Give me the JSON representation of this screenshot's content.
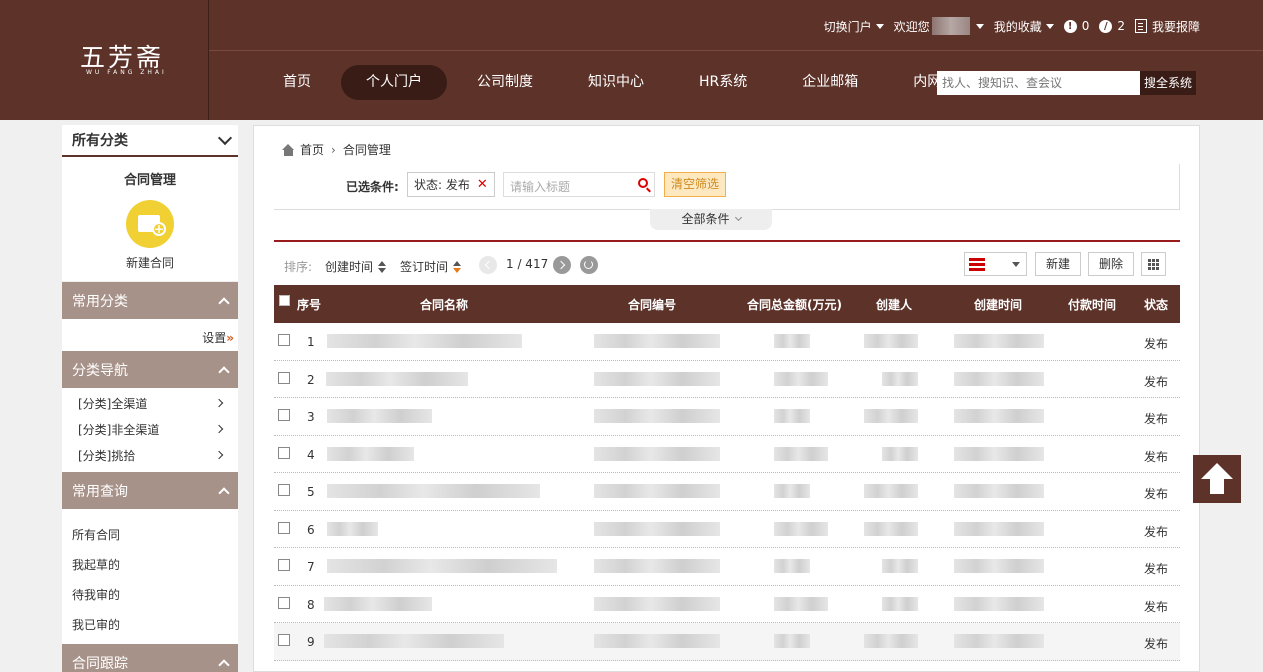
{
  "header": {
    "logo": "五芳斋",
    "logo_sub": "WU FANG ZHAI",
    "top_links": {
      "switch_portal": "切换门户",
      "welcome": "欢迎您",
      "favorites": "我的收藏",
      "alerts_count": "0",
      "tasks_count": "2",
      "report": "我要报障"
    },
    "nav": [
      "首页",
      "个人门户",
      "公司制度",
      "知识中心",
      "HR系统",
      "企业邮箱",
      "内网"
    ],
    "search_placeholder": "找人、搜知识、查会议",
    "search_button": "搜全系统"
  },
  "sidebar": {
    "all_categories": "所有分类",
    "module_title": "合同管理",
    "new_contract": "新建合同",
    "common_categories": "常用分类",
    "settings": "设置",
    "category_nav": "分类导航",
    "category_items": [
      "[分类]全渠道",
      "[分类]非全渠道",
      "[分类]挑拾"
    ],
    "common_query": "常用查询",
    "query_items": [
      "所有合同",
      "我起草的",
      "待我审的",
      "我已审的"
    ],
    "contract_tracking": "合同跟踪"
  },
  "main": {
    "breadcrumb": [
      "首页",
      "合同管理"
    ],
    "filter": {
      "selected_label": "已选条件:",
      "chip": "状态: 发布",
      "search_placeholder": "请输入标题",
      "clear": "清空筛选",
      "all_conditions": "全部条件"
    },
    "toolbar": {
      "sort_label": "排序:",
      "sort_created": "创建时间",
      "sort_signed": "签订时间",
      "page": "1 / 417",
      "new": "新建",
      "delete": "删除"
    },
    "table": {
      "columns": [
        "序号",
        "合同名称",
        "合同编号",
        "合同总金额(万元)",
        "创建人",
        "创建时间",
        "付款时间",
        "状态"
      ],
      "rows": [
        {
          "idx": "1",
          "status": "发布"
        },
        {
          "idx": "2",
          "status": "发布"
        },
        {
          "idx": "3",
          "status": "发布"
        },
        {
          "idx": "4",
          "status": "发布"
        },
        {
          "idx": "5",
          "status": "发布"
        },
        {
          "idx": "6",
          "status": "发布"
        },
        {
          "idx": "7",
          "status": "发布"
        },
        {
          "idx": "8",
          "status": "发布"
        },
        {
          "idx": "9",
          "status": "发布"
        }
      ]
    }
  }
}
